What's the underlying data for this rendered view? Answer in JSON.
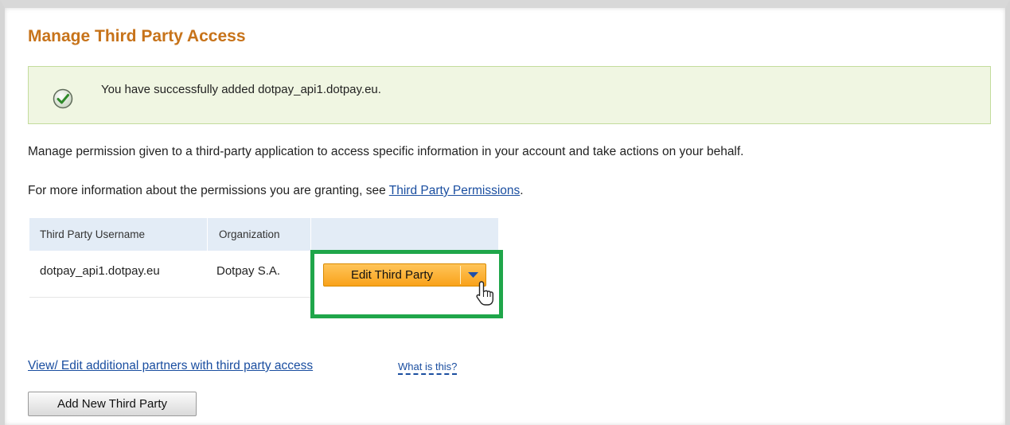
{
  "page": {
    "title": "Manage Third Party Access"
  },
  "success": {
    "message": "You have successfully added dotpay_api1.dotpay.eu.",
    "icon": "check-circle-icon"
  },
  "intro": {
    "description": "Manage permission given to a third-party application to access specific information in your account and take actions on your behalf.",
    "more_info_prefix": "For more information about the permissions you are granting, see ",
    "more_info_link": "Third Party Permissions",
    "more_info_suffix": "."
  },
  "table": {
    "headers": [
      "Third Party Username",
      "Organization",
      ""
    ],
    "rows": [
      {
        "username": "dotpay_api1.dotpay.eu",
        "organization": "Dotpay S.A.",
        "action_label": "Edit Third Party"
      }
    ]
  },
  "links": {
    "partners": "View/ Edit additional partners with third party access",
    "what_is_this": "What is this?"
  },
  "buttons": {
    "add_new": "Add New Third Party"
  },
  "colors": {
    "title": "#c7731a",
    "success_bg": "#f0f6e2",
    "highlight": "#1fa64a",
    "edit_button": "#f9a21a",
    "link": "#1a4ea0"
  }
}
